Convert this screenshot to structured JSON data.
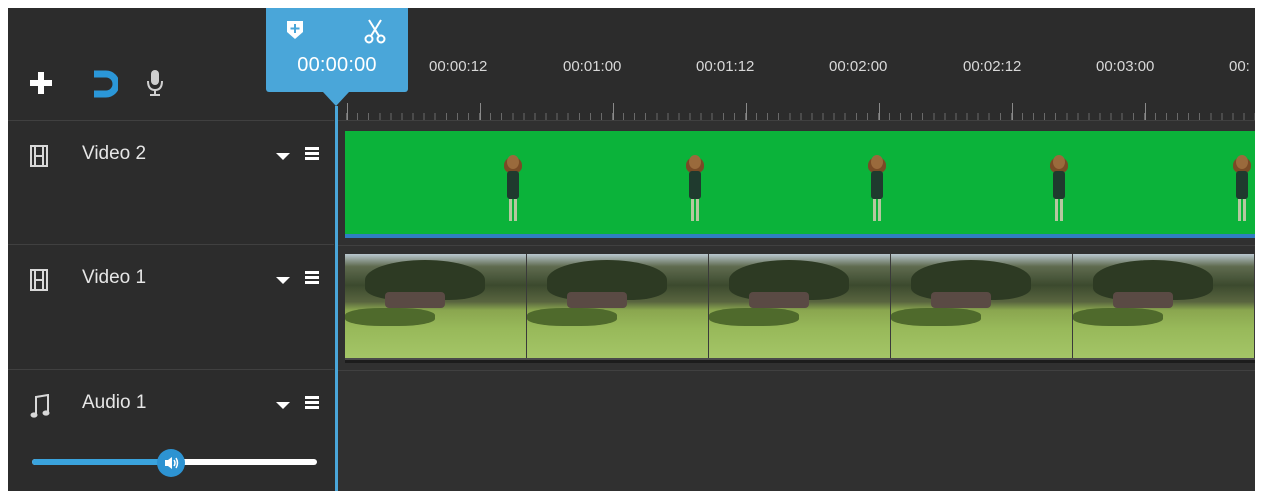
{
  "toolbar": {
    "add_icon": "plus-icon",
    "snap_icon": "magnet-icon",
    "record_icon": "microphone-icon"
  },
  "playhead": {
    "time": "00:00:00",
    "marker_icon": "add-marker-icon",
    "cut_icon": "scissors-icon",
    "color": "#4aa6d9"
  },
  "ruler": {
    "labels": [
      "00:00:12",
      "00:01:00",
      "00:01:12",
      "00:02:00",
      "00:02:12",
      "00:03:00",
      "00:"
    ]
  },
  "tracks": [
    {
      "name": "Video 2",
      "type": "video",
      "icon": "film-icon",
      "clip": "green-screen-character-clip"
    },
    {
      "name": "Video 1",
      "type": "video",
      "icon": "film-icon",
      "clip": "park-scene-clip"
    },
    {
      "name": "Audio 1",
      "type": "audio",
      "icon": "music-note-icon",
      "volume_fraction": 0.5
    }
  ],
  "colors": {
    "background": "#2c2c2c",
    "accent": "#4aa6d9",
    "green_screen": "#0bb33a"
  }
}
